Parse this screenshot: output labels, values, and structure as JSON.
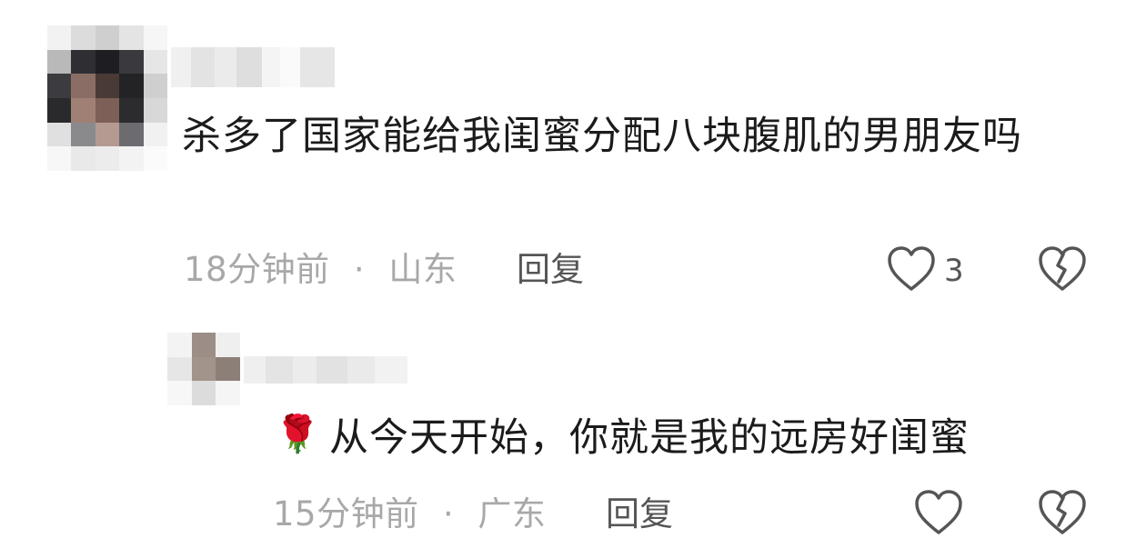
{
  "comments": [
    {
      "text": "杀多了国家能给我闺蜜分配八块腹肌的男朋友吗",
      "time": "18分钟前",
      "separator": "·",
      "location": "山东",
      "reply_label": "回复",
      "like_count": "3",
      "like_icon": "heart-outline-icon",
      "dislike_icon": "broken-heart-icon"
    },
    {
      "emoji": "🌹",
      "emoji_icon": "rose-icon",
      "text": "从今天开始，你就是我的远房好闺蜜",
      "time": "15分钟前",
      "separator": "·",
      "location": "广东",
      "reply_label": "回复",
      "like_icon": "heart-outline-icon",
      "dislike_icon": "broken-heart-icon"
    }
  ],
  "colors": {
    "text": "#1b1b1b",
    "meta": "#a8a8a8",
    "action": "#555555",
    "background": "#ffffff"
  }
}
